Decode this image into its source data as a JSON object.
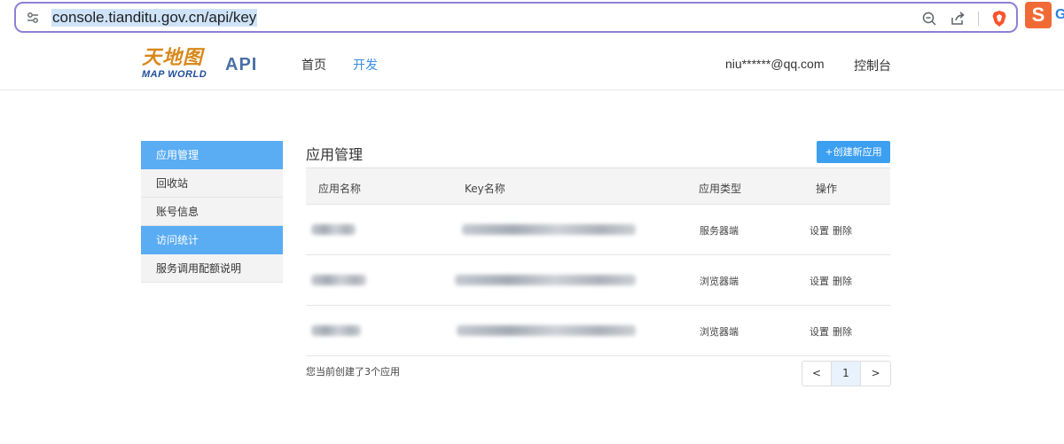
{
  "browser": {
    "url": "console.tianditu.gov.cn/api/key",
    "ext_label": "S",
    "ext2_label": "G"
  },
  "header": {
    "logo_cn": "天地图",
    "logo_en": "MAP WORLD",
    "api_label": "API",
    "nav": [
      {
        "label": "首页"
      },
      {
        "label": "开发"
      }
    ],
    "user_email": "niu******@qq.com",
    "console_label": "控制台"
  },
  "sidebar": {
    "items": [
      {
        "label": "应用管理",
        "active": true
      },
      {
        "label": "回收站"
      },
      {
        "label": "账号信息"
      },
      {
        "label": "访问统计",
        "active": true
      },
      {
        "label": "服务调用配额说明"
      }
    ]
  },
  "main": {
    "title": "应用管理",
    "create_button": "+创建新应用",
    "columns": [
      "应用名称",
      "Key名称",
      "应用类型",
      "操作"
    ],
    "rows": [
      {
        "type": "服务器端",
        "settings": "设置",
        "delete": "删除"
      },
      {
        "type": "浏览器端",
        "settings": "设置",
        "delete": "删除"
      },
      {
        "type": "浏览器端",
        "settings": "设置",
        "delete": "删除"
      }
    ],
    "summary": "您当前创建了3个应用",
    "pager": {
      "prev": "<",
      "current": "1",
      "next": ">"
    }
  },
  "colors": {
    "accent": "#3c9ff0",
    "sidebar_active": "#5aacf3",
    "url_border": "#8f7fd6"
  }
}
